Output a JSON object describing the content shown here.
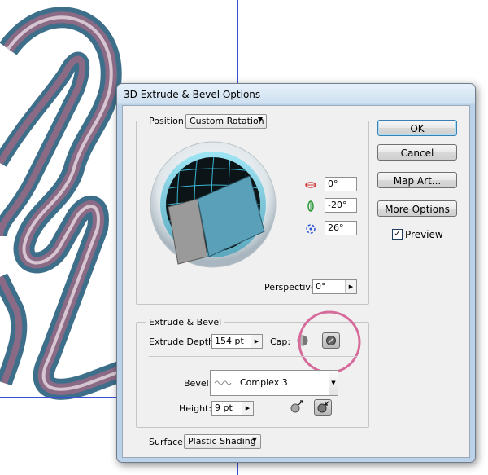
{
  "dialog": {
    "title": "3D Extrude & Bevel Options",
    "buttons": {
      "ok": "OK",
      "cancel": "Cancel",
      "map_art": "Map Art...",
      "more_options": "More Options"
    },
    "preview": {
      "label": "Preview",
      "checked": true
    }
  },
  "position": {
    "label": "Position:",
    "preset": "Custom Rotation",
    "rotation_x": "0°",
    "rotation_y": "-20°",
    "rotation_z": "26°",
    "perspective_label": "Perspective:",
    "perspective_value": "0°"
  },
  "extrude": {
    "group_title": "Extrude & Bevel",
    "depth_label": "Extrude Depth:",
    "depth_value": "154 pt",
    "cap_label": "Cap:",
    "bevel_label": "Bevel:",
    "bevel_value": "Complex 3",
    "height_label": "Height:",
    "height_value": "9 pt"
  },
  "surface": {
    "label": "Surface:",
    "value": "Plastic Shading"
  },
  "colors": {
    "cube_front": "#5aa0b8",
    "cube_side": "#9a9a9a",
    "highlight_circle": "#d66a9a",
    "grid_line": "#3bb6d2",
    "shape_stroke": "#3e6f8a"
  },
  "icons": {
    "rot_x": "rotate-x-icon",
    "rot_y": "rotate-y-icon",
    "rot_z": "rotate-z-icon"
  }
}
